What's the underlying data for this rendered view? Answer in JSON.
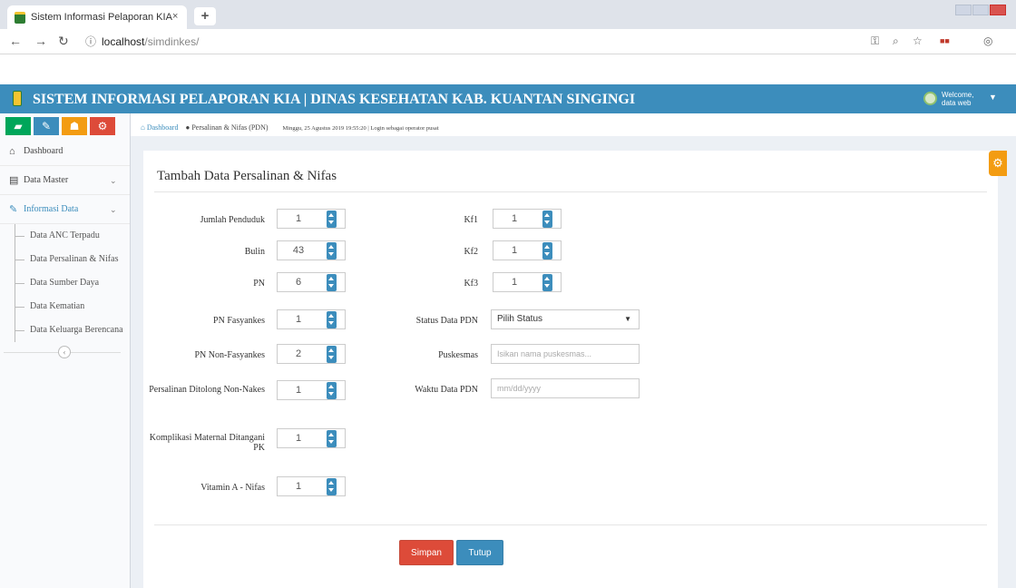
{
  "browser": {
    "tab_title": "Sistem Informasi Pelaporan KIA",
    "tab_close": "×",
    "new_tab": "+",
    "url_host": "localhost",
    "url_path": "/simdinkes/"
  },
  "header": {
    "title": "SISTEM INFORMASI PELAPORAN KIA | DINAS KESEHATAN KAB. KUANTAN SINGINGI",
    "welcome": "Welcome,",
    "user": "data web",
    "bg_color": "#3c8dbc"
  },
  "sidebar": {
    "buttons": [
      {
        "icon": "chart-icon",
        "color": "#00a65a"
      },
      {
        "icon": "pencil-icon",
        "color": "#3c8dbc"
      },
      {
        "icon": "users-icon",
        "color": "#f39c12"
      },
      {
        "icon": "cogs-icon",
        "color": "#dd4b39"
      }
    ],
    "items": [
      {
        "label": "Dashboard",
        "icon": "home-icon"
      },
      {
        "label": "Data Master",
        "icon": "table-icon"
      },
      {
        "label": "Informasi Data",
        "icon": "edit-icon"
      }
    ],
    "subitems": [
      "Data ANC Terpadu",
      "Data Persalinan & Nifas",
      "Data Sumber Daya",
      "Data Kematian",
      "Data Keluarga Berencana"
    ]
  },
  "breadcrumb": {
    "home": "Dashboard",
    "current": "Persalinan & Nifas (PDN)",
    "datetime": "Minggu, 25 Agustus 2019 19:55:20 | Login sebagai operator pusat"
  },
  "form": {
    "title": "Tambah Data Persalinan & Nifas",
    "left_fields": [
      {
        "label": "Jumlah Penduduk",
        "value": "1"
      },
      {
        "label": "Bulin",
        "value": "43"
      },
      {
        "label": "PN",
        "value": "6"
      },
      {
        "label": "PN Fasyankes",
        "value": "1"
      },
      {
        "label": "PN Non-Fasyankes",
        "value": "2"
      },
      {
        "label": "Persalinan Ditolong Non-Nakes",
        "value": "1"
      },
      {
        "label": "Komplikasi Maternal Ditangani PK",
        "value": "1"
      },
      {
        "label": "Vitamin A - Nifas",
        "value": "1"
      }
    ],
    "right_fields": [
      {
        "label": "Kf1",
        "value": "1"
      },
      {
        "label": "Kf2",
        "value": "1"
      },
      {
        "label": "Kf3",
        "value": "1"
      }
    ],
    "status_label": "Status Data PDN",
    "status_value": "Pilih Status",
    "puskesmas_label": "Puskesmas",
    "puskesmas_placeholder": "Isikan nama puskesmas...",
    "waktu_label": "Waktu Data PDN",
    "waktu_placeholder": "mm/dd/yyyy",
    "save_label": "Simpan",
    "close_label": "Tutup",
    "save_color": "#dd4b39",
    "close_color": "#3c8dbc"
  }
}
